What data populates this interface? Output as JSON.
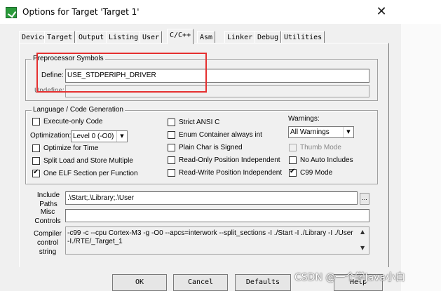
{
  "window": {
    "title": "Options for Target 'Target 1'",
    "close_glyph": "✕"
  },
  "tabs": [
    "Device",
    "Target",
    "Output",
    "Listing",
    "User",
    "C/C++",
    "Asm",
    "Linker",
    "Debug",
    "Utilities"
  ],
  "active_tab": "C/C++",
  "preprocessor": {
    "group_title": "Preprocessor Symbols",
    "define_label": "Define:",
    "define_value": "USE_STDPERIPH_DRIVER",
    "undefine_label": "Undefine:",
    "undefine_value": ""
  },
  "language": {
    "group_title": "Language / Code Generation",
    "execute_only": {
      "label": "Execute-only Code",
      "checked": false
    },
    "optimization_label": "Optimization:",
    "optimization_value": "Level 0 (-O0)",
    "optimize_time": {
      "label": "Optimize for Time",
      "checked": false
    },
    "split_load": {
      "label": "Split Load and Store Multiple",
      "checked": false
    },
    "one_elf": {
      "label": "One ELF Section per Function",
      "checked": true
    },
    "strict_ansi": {
      "label": "Strict ANSI C",
      "checked": false
    },
    "enum_container": {
      "label": "Enum Container always int",
      "checked": false
    },
    "plain_char": {
      "label": "Plain Char is Signed",
      "checked": false
    },
    "ro_pi": {
      "label": "Read-Only Position Independent",
      "checked": false
    },
    "rw_pi": {
      "label": "Read-Write Position Independent",
      "checked": false
    },
    "warnings_label": "Warnings:",
    "warnings_value": "All Warnings",
    "thumb_mode": {
      "label": "Thumb Mode",
      "checked": false
    },
    "no_auto_includes": {
      "label": "No Auto Includes",
      "checked": false
    },
    "c99_mode": {
      "label": "C99 Mode",
      "checked": true
    }
  },
  "include": {
    "label": "Include\nPaths",
    "label_line1": "Include",
    "label_line2": "Paths",
    "value": ".\\Start;.\\Library;.\\User",
    "browse": "..."
  },
  "misc": {
    "label_line1": "Misc",
    "label_line2": "Controls",
    "value": ""
  },
  "compiler": {
    "label_line1": "Compiler",
    "label_line2": "control",
    "label_line3": "string",
    "line1": "-c99 -c --cpu Cortex-M3 -g -O0 --apcs=interwork --split_sections -I ./Start -I ./Library -I ./User",
    "line2": "-I./RTE/_Target_1"
  },
  "buttons": {
    "ok": "OK",
    "cancel": "Cancel",
    "defaults": "Defaults",
    "help": "Help"
  },
  "watermark": "CSDN @一个学Java小白",
  "colors": {
    "highlight_box": "#e53030"
  }
}
